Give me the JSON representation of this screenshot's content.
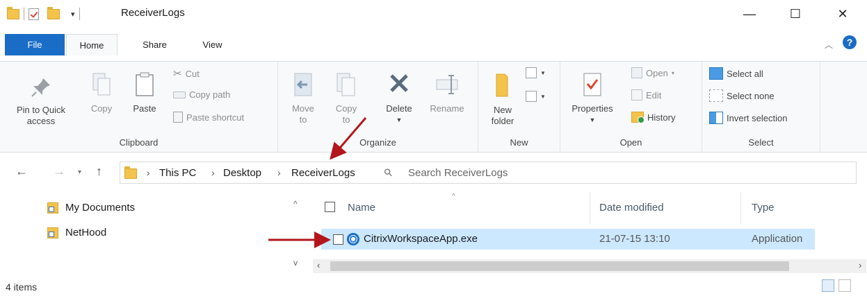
{
  "window": {
    "title": "ReceiverLogs",
    "controls": {
      "minimize": "—",
      "maximize": "☐",
      "close": "✕"
    }
  },
  "tabs": [
    "File",
    "Home",
    "Share",
    "View"
  ],
  "ribbon": {
    "clipboard": {
      "label": "Clipboard",
      "pin_line1": "Pin to Quick",
      "pin_line2": "access",
      "copy": "Copy",
      "paste": "Paste",
      "cut": "Cut",
      "copy_path": "Copy path",
      "paste_shortcut": "Paste shortcut"
    },
    "organize": {
      "label": "Organize",
      "move_line1": "Move",
      "move_line2": "to",
      "copy_line1": "Copy",
      "copy_line2": "to",
      "delete": "Delete",
      "rename": "Rename"
    },
    "new": {
      "label": "New",
      "folder_line1": "New",
      "folder_line2": "folder"
    },
    "open": {
      "label": "Open",
      "properties": "Properties",
      "open": "Open",
      "edit": "Edit",
      "history": "History"
    },
    "select": {
      "label": "Select",
      "select_all": "Select all",
      "select_none": "Select none",
      "invert": "Invert selection"
    }
  },
  "address": {
    "crumbs": [
      "This PC",
      "Desktop",
      "ReceiverLogs"
    ],
    "search_placeholder": "Search ReceiverLogs"
  },
  "nav_pane": {
    "items": [
      "My Documents",
      "NetHood"
    ]
  },
  "file_list": {
    "columns": [
      "Name",
      "Date modified",
      "Type"
    ],
    "rows": [
      {
        "name": "CitrixWorkspaceApp.exe",
        "date": "21-07-15 13:10",
        "type": "Application"
      }
    ]
  },
  "status": {
    "item_count": "4 items"
  },
  "colors": {
    "accent": "#1a6dc6",
    "selection": "#cce8ff",
    "annotation_arrow": "#b3161b"
  }
}
